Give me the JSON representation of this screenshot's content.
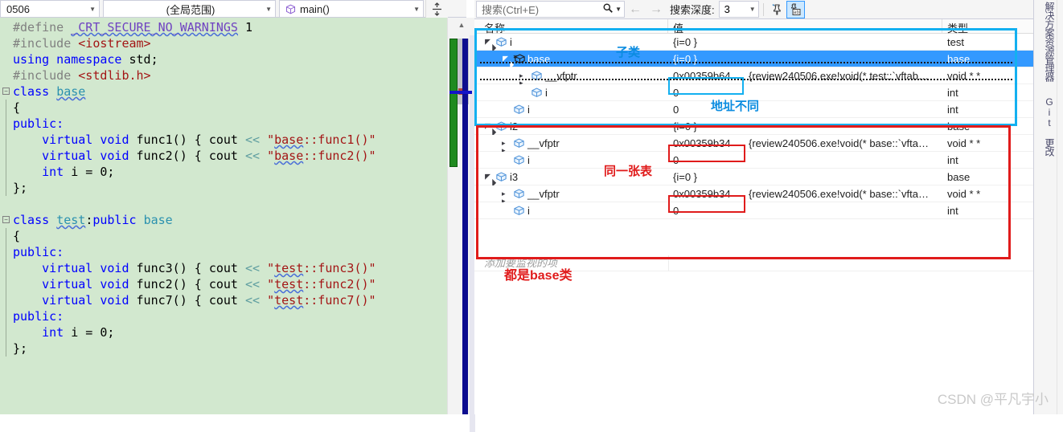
{
  "editor_toolbar": {
    "file_combo": "0506",
    "scope_combo": "(全局范围)",
    "function_combo": "main()",
    "function_icon": "cube-icon",
    "splitter_icon": "split-window-icon",
    "caret_icon": "chevron-down-icon"
  },
  "code": {
    "lines": [
      {
        "fold": false,
        "tokens": [
          {
            "t": "#define ",
            "c": "pp"
          },
          {
            "t": "_CRT_SECURE_NO_WARNINGS",
            "c": "mac sq"
          },
          {
            "t": " 1",
            "c": "num"
          }
        ]
      },
      {
        "fold": false,
        "tokens": [
          {
            "t": "#include ",
            "c": "pp"
          },
          {
            "t": "<iostream>",
            "c": "str"
          }
        ]
      },
      {
        "fold": false,
        "tokens": [
          {
            "t": "using namespace ",
            "c": "kw"
          },
          {
            "t": "std;",
            "c": "plain"
          }
        ]
      },
      {
        "fold": false,
        "tokens": [
          {
            "t": "#include ",
            "c": "pp"
          },
          {
            "t": "<stdlib.h>",
            "c": "str"
          }
        ]
      },
      {
        "fold": true,
        "tokens": [
          {
            "t": "class ",
            "c": "kw"
          },
          {
            "t": "base",
            "c": "cls sq"
          }
        ]
      },
      {
        "fold": false,
        "guide": true,
        "tokens": [
          {
            "t": "{",
            "c": "plain"
          }
        ]
      },
      {
        "fold": false,
        "guide": true,
        "tokens": [
          {
            "t": "public:",
            "c": "kw"
          }
        ]
      },
      {
        "fold": false,
        "guide": true,
        "tokens": [
          {
            "t": "    ",
            "c": "plain"
          },
          {
            "t": "virtual void ",
            "c": "kw"
          },
          {
            "t": "func1() { ",
            "c": "plain"
          },
          {
            "t": "cout ",
            "c": "plain"
          },
          {
            "t": "<< ",
            "c": "op"
          },
          {
            "t": "\"",
            "c": "str"
          },
          {
            "t": "base",
            "c": "str sq"
          },
          {
            "t": "::func1()\"",
            "c": "str"
          }
        ]
      },
      {
        "fold": false,
        "guide": true,
        "tokens": [
          {
            "t": "    ",
            "c": "plain"
          },
          {
            "t": "virtual void ",
            "c": "kw"
          },
          {
            "t": "func2() { ",
            "c": "plain"
          },
          {
            "t": "cout ",
            "c": "plain"
          },
          {
            "t": "<< ",
            "c": "op"
          },
          {
            "t": "\"",
            "c": "str"
          },
          {
            "t": "base",
            "c": "str sq"
          },
          {
            "t": "::func2()\"",
            "c": "str"
          }
        ]
      },
      {
        "fold": false,
        "guide": true,
        "tokens": [
          {
            "t": "    ",
            "c": "plain"
          },
          {
            "t": "int ",
            "c": "kw"
          },
          {
            "t": "i = ",
            "c": "plain"
          },
          {
            "t": "0;",
            "c": "plain"
          }
        ]
      },
      {
        "fold": false,
        "guide": true,
        "tokens": [
          {
            "t": "};",
            "c": "plain"
          }
        ]
      },
      {
        "fold": false,
        "tokens": [
          {
            "t": "",
            "c": "plain"
          }
        ]
      },
      {
        "fold": true,
        "tokens": [
          {
            "t": "class ",
            "c": "kw"
          },
          {
            "t": "test",
            "c": "cls sq"
          },
          {
            "t": ":",
            "c": "plain"
          },
          {
            "t": "public ",
            "c": "kw"
          },
          {
            "t": "base",
            "c": "cls"
          }
        ]
      },
      {
        "fold": false,
        "guide": true,
        "tokens": [
          {
            "t": "{",
            "c": "plain"
          }
        ]
      },
      {
        "fold": false,
        "guide": true,
        "tokens": [
          {
            "t": "public:",
            "c": "kw"
          }
        ]
      },
      {
        "fold": false,
        "guide": true,
        "tokens": [
          {
            "t": "    ",
            "c": "plain"
          },
          {
            "t": "virtual void ",
            "c": "kw"
          },
          {
            "t": "func3() { ",
            "c": "plain"
          },
          {
            "t": "cout ",
            "c": "plain"
          },
          {
            "t": "<< ",
            "c": "op"
          },
          {
            "t": "\"",
            "c": "str"
          },
          {
            "t": "test",
            "c": "str sq"
          },
          {
            "t": "::func3()\"",
            "c": "str"
          }
        ]
      },
      {
        "fold": false,
        "guide": true,
        "tokens": [
          {
            "t": "    ",
            "c": "plain"
          },
          {
            "t": "virtual void ",
            "c": "kw"
          },
          {
            "t": "func2() { ",
            "c": "plain"
          },
          {
            "t": "cout ",
            "c": "plain"
          },
          {
            "t": "<< ",
            "c": "op"
          },
          {
            "t": "\"",
            "c": "str"
          },
          {
            "t": "test",
            "c": "str sq"
          },
          {
            "t": "::func2()\"",
            "c": "str"
          }
        ]
      },
      {
        "fold": false,
        "guide": true,
        "tokens": [
          {
            "t": "    ",
            "c": "plain"
          },
          {
            "t": "virtual void ",
            "c": "kw"
          },
          {
            "t": "func7() { ",
            "c": "plain"
          },
          {
            "t": "cout ",
            "c": "plain"
          },
          {
            "t": "<< ",
            "c": "op"
          },
          {
            "t": "\"",
            "c": "str"
          },
          {
            "t": "test",
            "c": "str sq"
          },
          {
            "t": "::func7()\"",
            "c": "str"
          }
        ]
      },
      {
        "fold": false,
        "guide": true,
        "tokens": [
          {
            "t": "public:",
            "c": "kw"
          }
        ]
      },
      {
        "fold": false,
        "guide": true,
        "tokens": [
          {
            "t": "    ",
            "c": "plain"
          },
          {
            "t": "int ",
            "c": "kw"
          },
          {
            "t": "i = ",
            "c": "plain"
          },
          {
            "t": "0;",
            "c": "plain"
          }
        ]
      },
      {
        "fold": false,
        "guide": true,
        "tokens": [
          {
            "t": "};",
            "c": "plain"
          }
        ]
      }
    ]
  },
  "watch_toolbar": {
    "search_placeholder": "搜索(Ctrl+E)",
    "search_icon": "magnifier-icon",
    "search_dropdown_icon": "chevron-down-icon",
    "back_icon": "arrow-left-icon",
    "forward_icon": "arrow-right-icon",
    "depth_label": "搜索深度:",
    "depth_value": "3",
    "pin_icon": "pin-icon",
    "hex_icon": "hex-display-icon"
  },
  "watch_table": {
    "columns": [
      "名称",
      "值",
      "类型"
    ],
    "rows": [
      {
        "indent": 0,
        "expander": "open",
        "name": "i",
        "value": "{i=0 }",
        "type": "test",
        "selected": false
      },
      {
        "indent": 1,
        "expander": "open",
        "name": "base",
        "value": "{i=0 }",
        "type": "base",
        "selected": true,
        "icon": "base-class-icon"
      },
      {
        "indent": 2,
        "expander": "closed",
        "name": "__vfptr",
        "value": "0x00359b64",
        "value2": "{review240506.exe!void(* test::`vftab…",
        "type": "void * *",
        "selected": false
      },
      {
        "indent": 2,
        "expander": "none",
        "name": "i",
        "value": "0",
        "type": "int",
        "selected": false
      },
      {
        "indent": 1,
        "expander": "none",
        "name": "i",
        "value": "0",
        "type": "int",
        "selected": false
      },
      {
        "indent": 0,
        "expander": "open",
        "name": "i2",
        "value": "{i=0 }",
        "type": "base",
        "selected": false
      },
      {
        "indent": 1,
        "expander": "closed",
        "name": "__vfptr",
        "value": "0x00359b34",
        "value2": "{review240506.exe!void(* base::`vfta…",
        "type": "void * *",
        "selected": false
      },
      {
        "indent": 1,
        "expander": "none",
        "name": "i",
        "value": "0",
        "type": "int",
        "selected": false
      },
      {
        "indent": 0,
        "expander": "open",
        "name": "i3",
        "value": "{i=0 }",
        "type": "base",
        "selected": false
      },
      {
        "indent": 1,
        "expander": "closed",
        "name": "__vfptr",
        "value": "0x00359b34",
        "value2": "{review240506.exe!void(* base::`vfta…",
        "type": "void * *",
        "selected": false
      },
      {
        "indent": 1,
        "expander": "none",
        "name": "i",
        "value": "0",
        "type": "int",
        "selected": false,
        "pin": "pin-value-icon"
      }
    ],
    "add_watch_placeholder": "添加要监视的项"
  },
  "annotations": [
    {
      "id": "ann-subclass",
      "text": "子类",
      "color": "#0b8ce0"
    },
    {
      "id": "ann-addr-diff",
      "text": "地址不同",
      "color": "#0b8ce0"
    },
    {
      "id": "ann-same-table",
      "text": "同一张表",
      "color": "#e01b1b"
    },
    {
      "id": "ann-all-base",
      "text": "都是base类",
      "color": "#e01b1b"
    }
  ],
  "right_rail": {
    "tabs": [
      "解决方案资源管理器",
      "Git 更改"
    ]
  },
  "watermark": "CSDN @平凡宇小",
  "colors": {
    "selection": "#3399ff",
    "blue_annotation": "#13b0f0",
    "red_annotation": "#e01b1b",
    "code_background": "#d2e8cf"
  }
}
